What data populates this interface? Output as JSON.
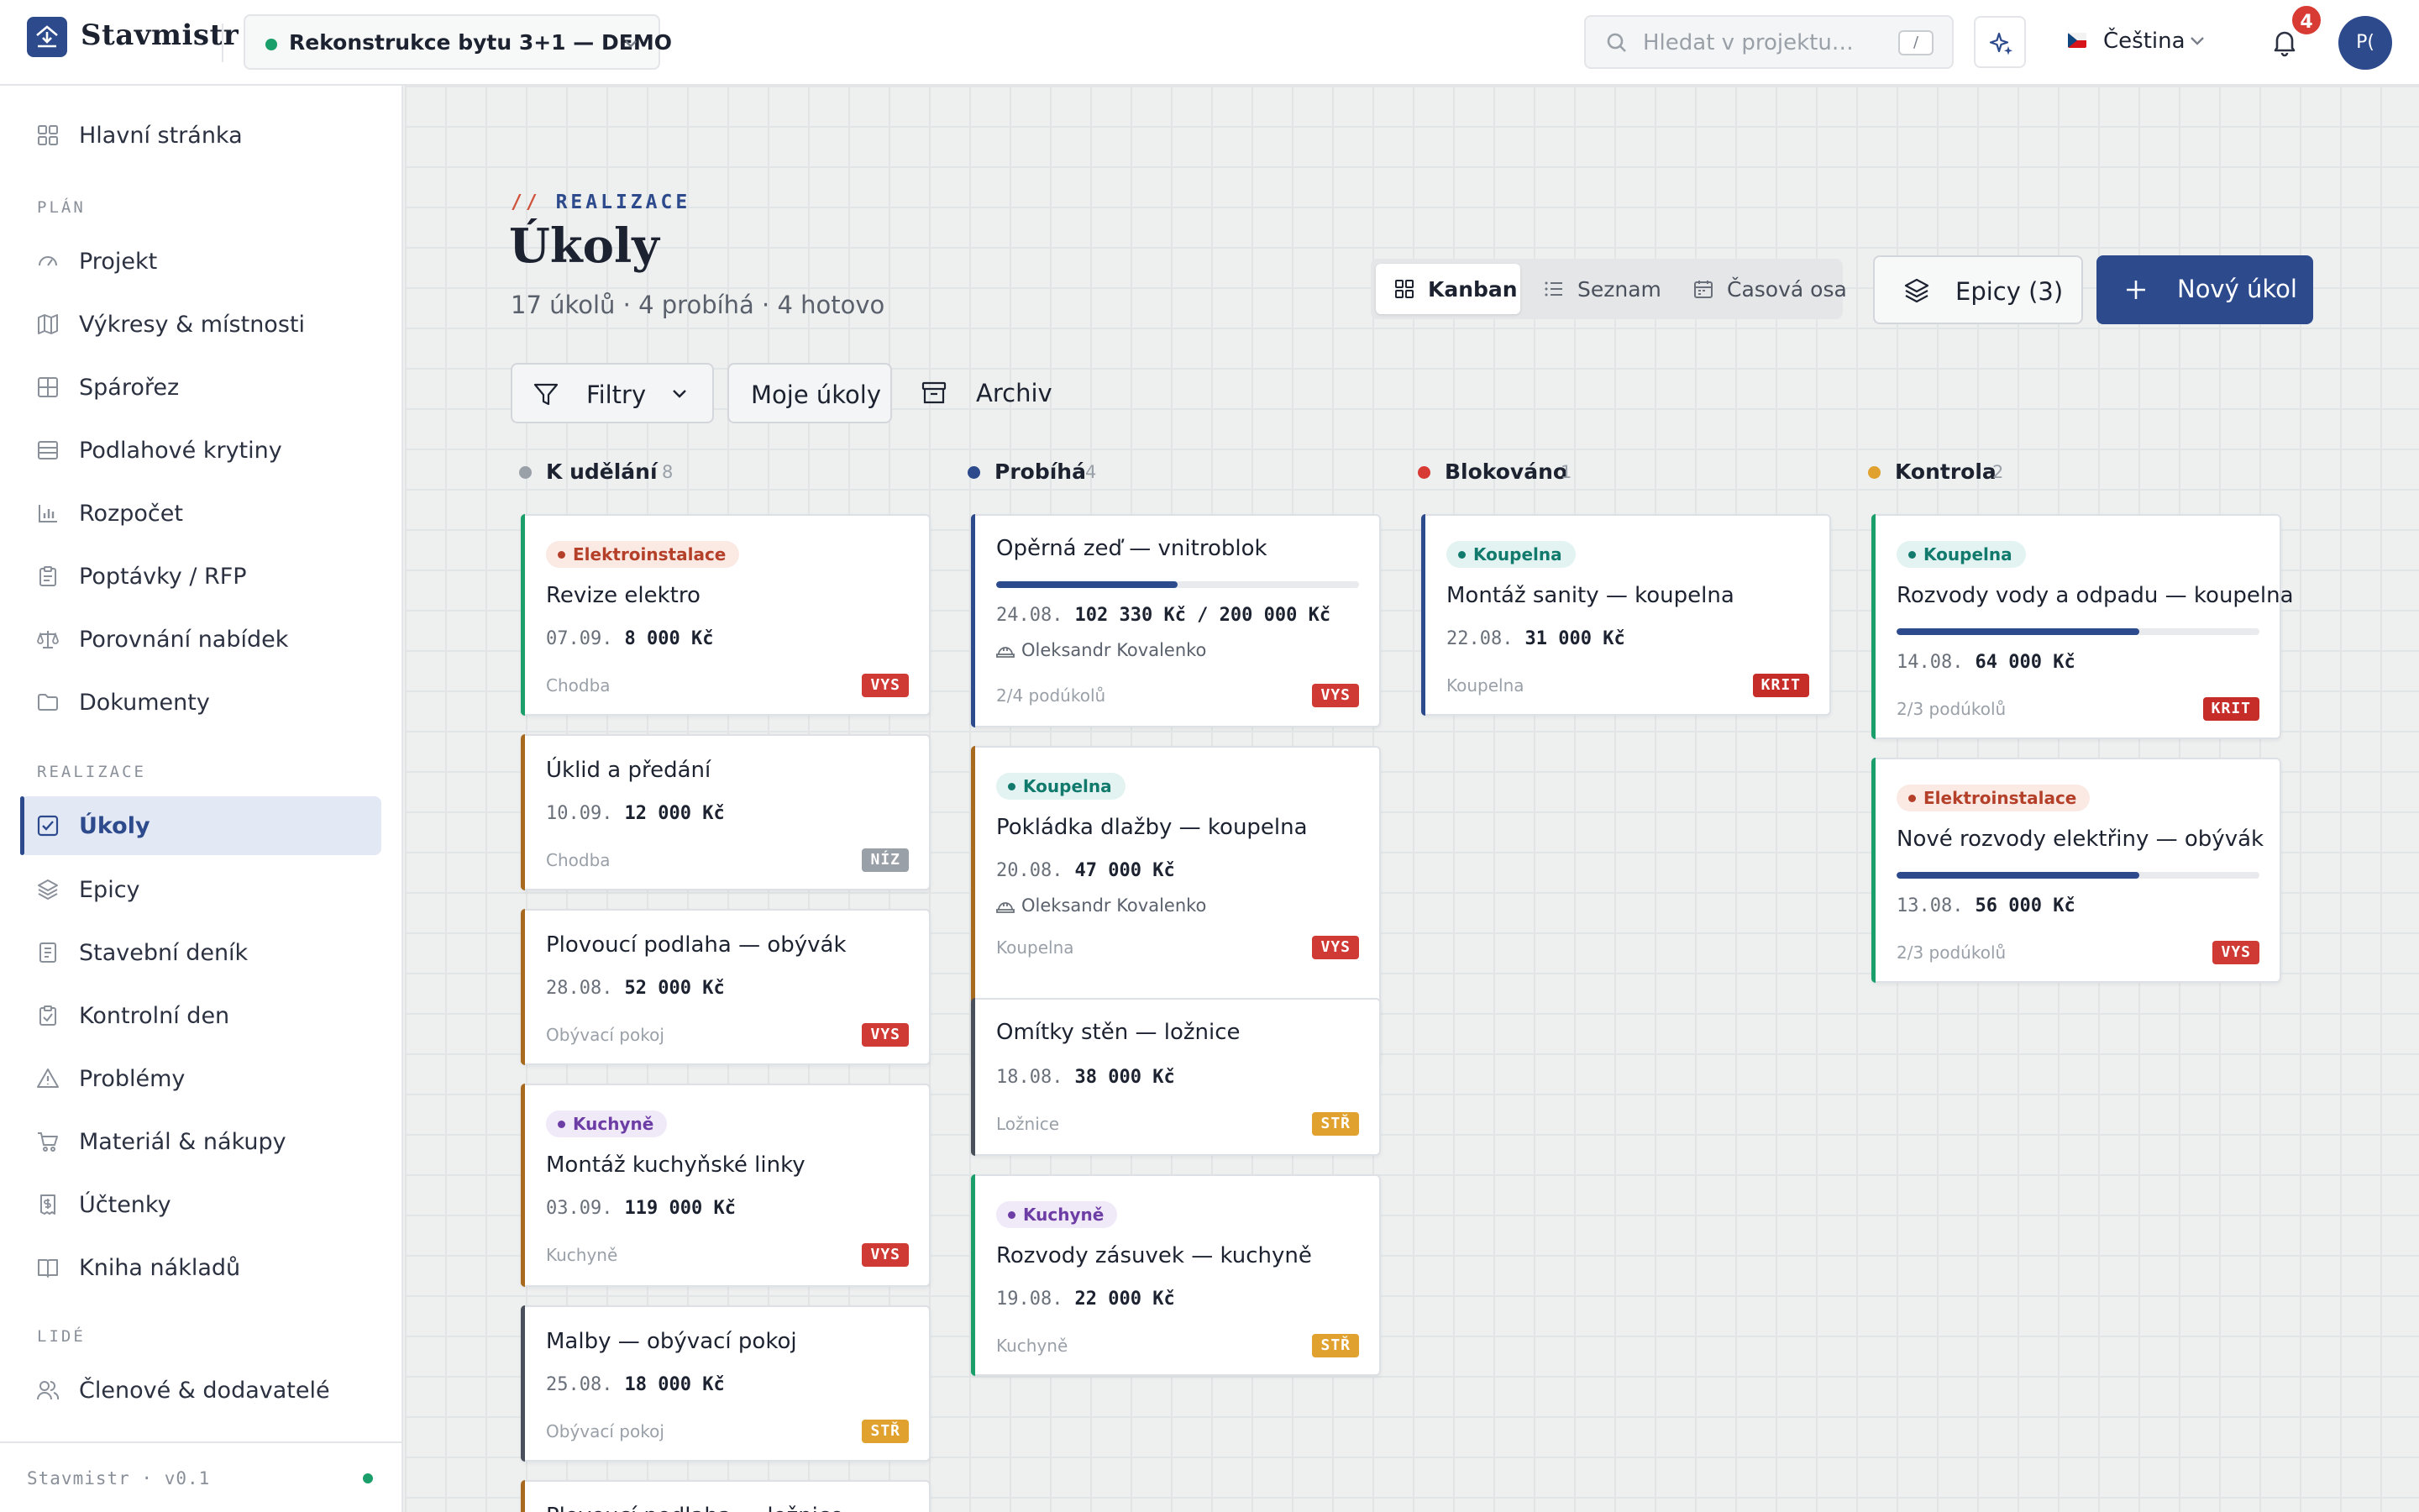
{
  "app": {
    "name": "Stavmistr",
    "version": "Stavmistr · v0.1"
  },
  "header": {
    "project": "Rekonstrukce bytu 3+1 — DEMO",
    "search_placeholder": "Hledat v projektu…",
    "search_shortcut": "/",
    "language": "Čeština",
    "notifications": "4",
    "avatar": "P("
  },
  "sidebar": {
    "home": "Hlavní stránka",
    "sections": {
      "plan": "PLÁN",
      "realizace": "REALIZACE",
      "lide": "LIDÉ"
    },
    "plan_items": [
      "Projekt",
      "Výkresy & místnosti",
      "Spárořez",
      "Podlahové krytiny",
      "Rozpočet",
      "Poptávky / RFP",
      "Porovnání nabídek",
      "Dokumenty"
    ],
    "realizace_items": [
      "Úkoly",
      "Epicy",
      "Stavební deník",
      "Kontrolní den",
      "Problémy",
      "Materiál & nákupy",
      "Účtenky",
      "Kniha nákladů"
    ],
    "lide_items": [
      "Členové & dodavatelé"
    ],
    "active": "Úkoly"
  },
  "page": {
    "eyebrow_prefix": "//",
    "eyebrow": "REALIZACE",
    "title": "Úkoly",
    "subtitle": "17 úkolů · 4 probíhá · 4 hotovo",
    "views": [
      "Kanban",
      "Seznam",
      "Časová osa"
    ],
    "active_view": "Kanban",
    "epics_button": "Epicy (3)",
    "new_button": "Nový úkol",
    "filters": "Filtry",
    "my_tasks": "Moje úkoly",
    "archive": "Archiv"
  },
  "colors": {
    "brand": "#2c4a8c",
    "status_todo": "#9aa0a8",
    "status_progress": "#2c4a8c",
    "status_blocked": "#d83a34",
    "status_review": "#e0a12e"
  },
  "board": {
    "columns": [
      {
        "name": "K udělání",
        "count": "8",
        "cards": [
          {
            "tag": "Elektroinstalace",
            "title": "Revize elektro",
            "date": "07.09.",
            "amount": "8 000 Kč",
            "room": "Chodba",
            "priority": "VYS"
          },
          {
            "title": "Úklid a předání",
            "date": "10.09.",
            "amount": "12 000 Kč",
            "room": "Chodba",
            "priority": "NÍZ"
          },
          {
            "title": "Plovoucí podlaha — obývák",
            "date": "28.08.",
            "amount": "52 000 Kč",
            "room": "Obývací pokoj",
            "priority": "VYS"
          },
          {
            "tag": "Kuchyně",
            "title": "Montáž kuchyňské linky",
            "date": "03.09.",
            "amount": "119 000 Kč",
            "room": "Kuchyně",
            "priority": "VYS"
          },
          {
            "title": "Malby — obývací pokoj",
            "date": "25.08.",
            "amount": "18 000 Kč",
            "room": "Obývací pokoj",
            "priority": "STŘ"
          },
          {
            "title": "Plovoucí podlaha — ložnice"
          }
        ]
      },
      {
        "name": "Probíhá",
        "count": "4",
        "cards": [
          {
            "title": "Opěrná zeď — vnitroblok",
            "progress": 0.5,
            "date": "24.08.",
            "amount": "102 330 Kč / 200 000 Kč",
            "assignee": "Oleksandr Kovalenko",
            "room": "2/4 podúkolů",
            "priority": "VYS"
          },
          {
            "tag": "Koupelna",
            "title": "Pokládka dlažby — koupelna",
            "date": "20.08.",
            "amount": "47 000 Kč",
            "assignee": "Oleksandr Kovalenko",
            "room": "Koupelna",
            "priority": "VYS"
          },
          {
            "title": "Omítky stěn — ložnice",
            "date": "18.08.",
            "amount": "38 000 Kč",
            "room": "Ložnice",
            "priority": "STŘ"
          },
          {
            "tag": "Kuchyně",
            "title": "Rozvody zásuvek — kuchyně",
            "date": "19.08.",
            "amount": "22 000 Kč",
            "room": "Kuchyně",
            "priority": "STŘ"
          }
        ]
      },
      {
        "name": "Blokováno",
        "count": "1",
        "cards": [
          {
            "tag": "Koupelna",
            "title": "Montáž sanity — koupelna",
            "date": "22.08.",
            "amount": "31 000 Kč",
            "room": "Koupelna",
            "priority": "KRIT"
          }
        ]
      },
      {
        "name": "Kontrola",
        "count": "2",
        "cards": [
          {
            "tag": "Koupelna",
            "title": "Rozvody vody a odpadu — koupelna",
            "progress": 0.67,
            "date": "14.08.",
            "amount": "64 000 Kč",
            "room": "2/3 podúkolů",
            "priority": "KRIT"
          },
          {
            "tag": "Elektroinstalace",
            "title": "Nové rozvody elektřiny — obývák",
            "progress": 0.67,
            "date": "13.08.",
            "amount": "56 000 Kč",
            "room": "2/3 podúkolů",
            "priority": "VYS"
          }
        ]
      }
    ]
  }
}
